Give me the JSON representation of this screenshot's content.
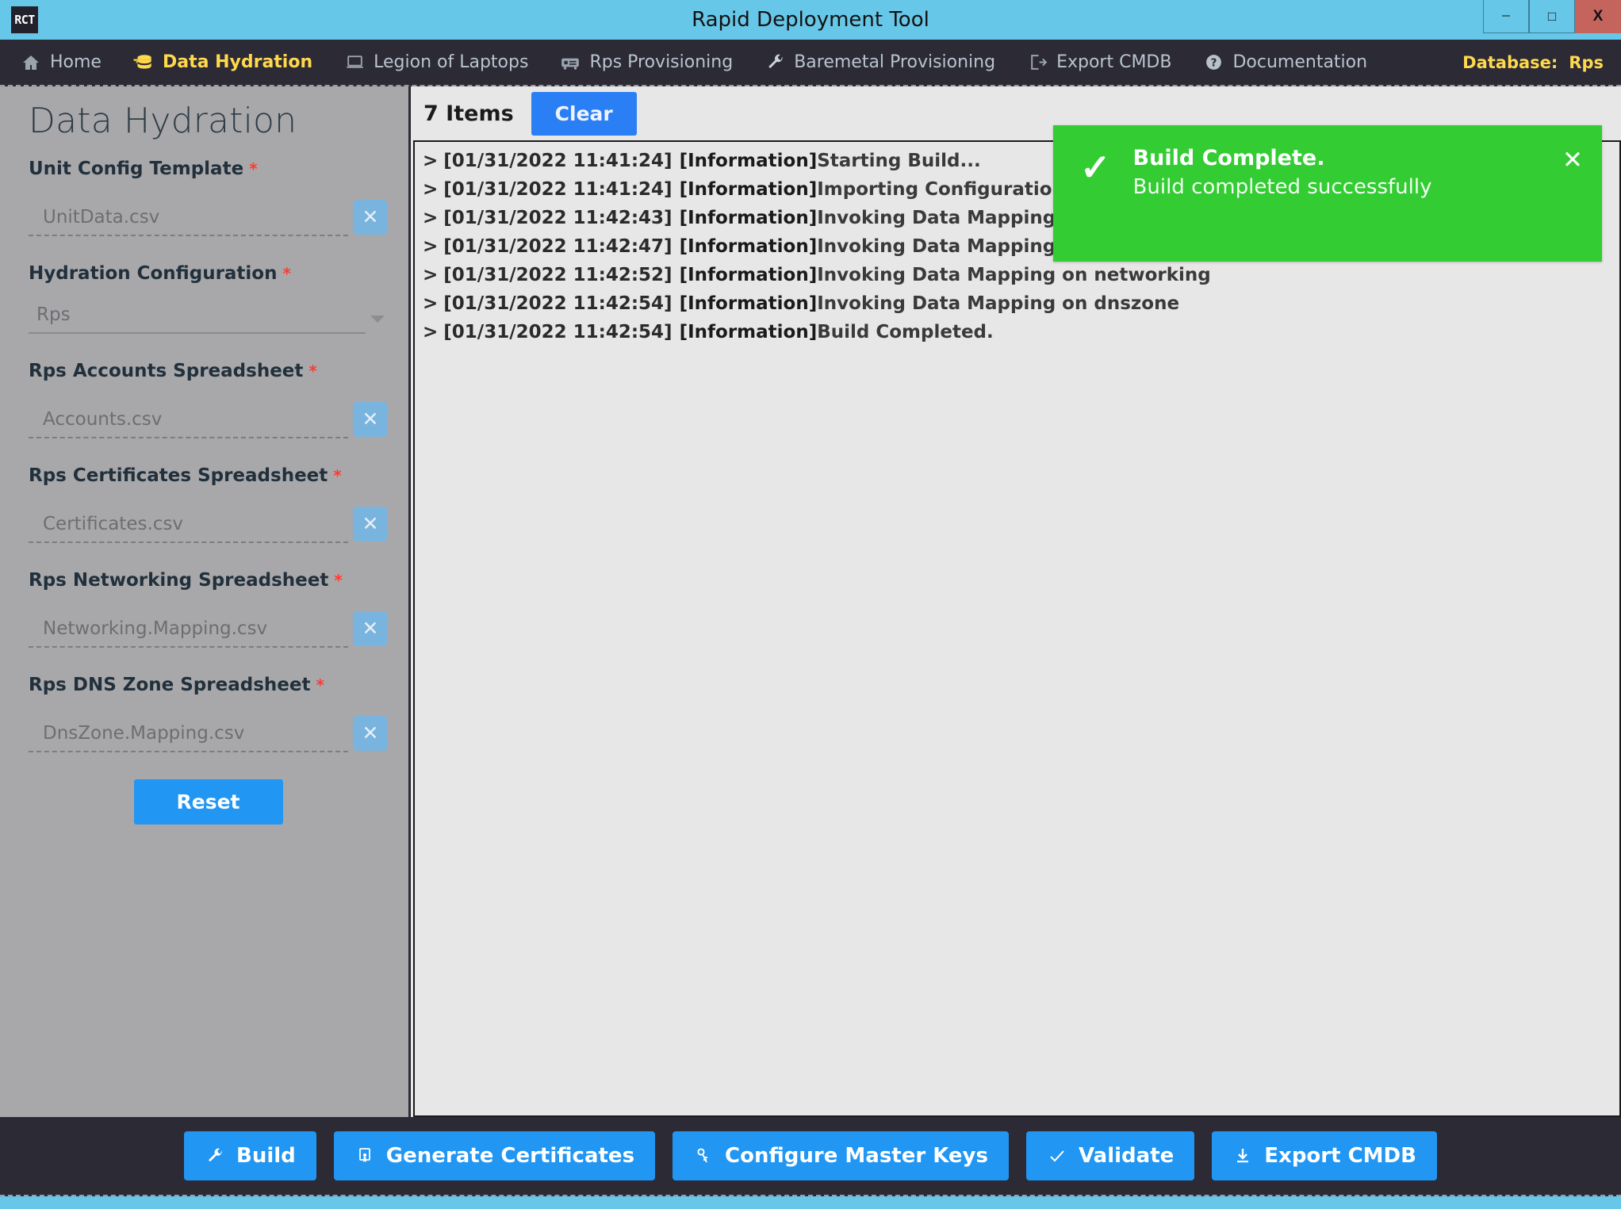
{
  "window": {
    "title": "Rapid Deployment Tool",
    "logo": "RCT",
    "controls": {
      "minimize": "–",
      "maximize": "❐",
      "close": "X"
    }
  },
  "nav": {
    "items": [
      {
        "label": "Home",
        "icon": "home-icon",
        "active": false
      },
      {
        "label": "Data Hydration",
        "icon": "database-stack-icon",
        "active": true
      },
      {
        "label": "Legion of Laptops",
        "icon": "laptop-icon",
        "active": false
      },
      {
        "label": "Rps Provisioning",
        "icon": "server-rack-icon",
        "active": false
      },
      {
        "label": "Baremetal Provisioning",
        "icon": "wrench-icon",
        "active": false
      },
      {
        "label": "Export CMDB",
        "icon": "export-arrow-icon",
        "active": false
      },
      {
        "label": "Documentation",
        "icon": "question-circle-icon",
        "active": false
      }
    ],
    "database_label": "Database:",
    "database_value": "Rps"
  },
  "sidebar": {
    "title": "Data Hydration",
    "required_marker": "*",
    "clear_icon": "✕",
    "fields": [
      {
        "label": "Unit Config Template",
        "value": "UnitData.csv",
        "type": "file",
        "required": true
      },
      {
        "label": "Hydration Configuration",
        "value": "Rps",
        "type": "select",
        "required": true
      },
      {
        "label": "Rps Accounts Spreadsheet",
        "value": "Accounts.csv",
        "type": "file",
        "required": true
      },
      {
        "label": "Rps Certificates Spreadsheet",
        "value": "Certificates.csv",
        "type": "file",
        "required": true
      },
      {
        "label": "Rps Networking Spreadsheet",
        "value": "Networking.Mapping.csv",
        "type": "file",
        "required": true
      },
      {
        "label": "Rps DNS Zone Spreadsheet",
        "value": "DnsZone.Mapping.csv",
        "type": "file",
        "required": true
      }
    ],
    "reset_label": "Reset"
  },
  "log": {
    "items_count": "7 Items",
    "clear_label": "Clear",
    "caret": ">",
    "entries": [
      {
        "timestamp": "[01/31/2022 11:41:24]",
        "level": "[Information]",
        "message": "Starting Build..."
      },
      {
        "timestamp": "[01/31/2022 11:41:24]",
        "level": "[Information]",
        "message": "Importing Configuration Item Provisioning Data"
      },
      {
        "timestamp": "[01/31/2022 11:42:43]",
        "level": "[Information]",
        "message": "Invoking Data Mapping on accounts"
      },
      {
        "timestamp": "[01/31/2022 11:42:47]",
        "level": "[Information]",
        "message": "Invoking Data Mapping on certificates"
      },
      {
        "timestamp": "[01/31/2022 11:42:52]",
        "level": "[Information]",
        "message": "Invoking Data Mapping on networking"
      },
      {
        "timestamp": "[01/31/2022 11:42:54]",
        "level": "[Information]",
        "message": "Invoking Data Mapping on dnszone"
      },
      {
        "timestamp": "[01/31/2022 11:42:54]",
        "level": "[Information]",
        "message": "Build Completed."
      }
    ]
  },
  "toast": {
    "icon": "check-icon",
    "title": "Build Complete.",
    "subtitle": "Build completed successfully",
    "close_icon": "✕",
    "color": "#33cc33"
  },
  "footer": {
    "buttons": [
      {
        "label": "Build",
        "icon": "wrench-icon"
      },
      {
        "label": "Generate Certificates",
        "icon": "certificate-icon"
      },
      {
        "label": "Configure Master Keys",
        "icon": "key-icon"
      },
      {
        "label": "Validate",
        "icon": "check-icon"
      },
      {
        "label": "Export CMDB",
        "icon": "download-icon"
      }
    ]
  },
  "colors": {
    "accent": "#2196f3",
    "titlebar": "#67c7e8",
    "navbar": "#2b2a35",
    "sidebar": "#a8a8ab",
    "panel": "#e7e7e7",
    "success": "#33cc33",
    "highlight": "#ffd84d",
    "required": "#ff3b30",
    "close": "#c4645c"
  }
}
